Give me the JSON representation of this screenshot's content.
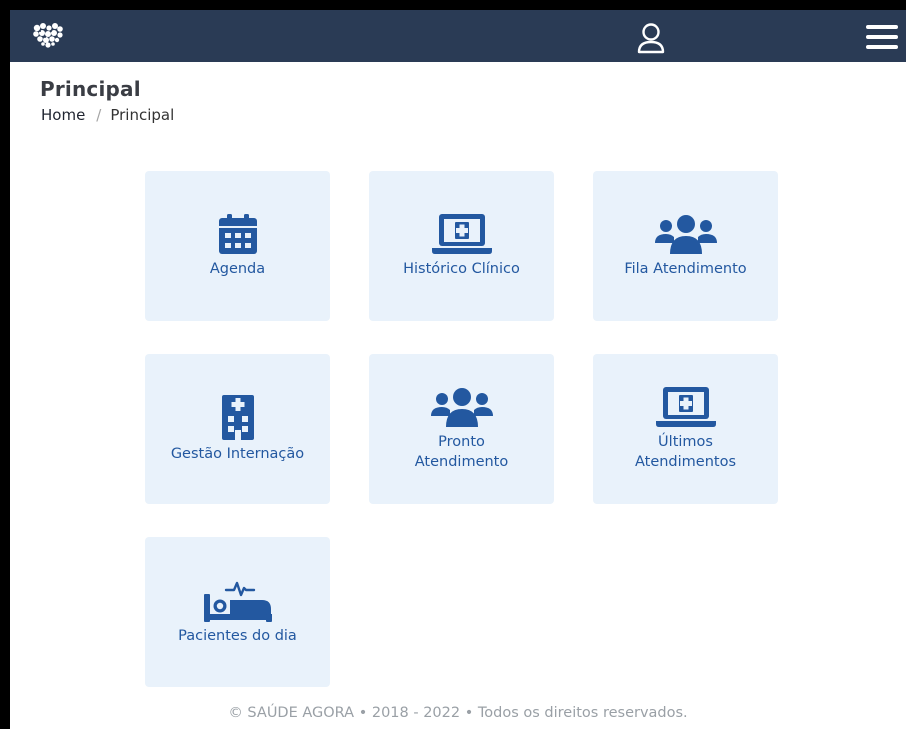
{
  "header": {
    "logo_icon": "heart-logo-icon",
    "user_icon": "user-icon",
    "menu_icon": "hamburger-menu-icon",
    "background_color": "#2a3b55"
  },
  "page": {
    "title": "Principal",
    "breadcrumb": {
      "home": "Home",
      "separator": "/",
      "current": "Principal"
    }
  },
  "tiles": [
    {
      "label": "Agenda",
      "icon": "calendar-icon"
    },
    {
      "label": "Histórico Clínico",
      "icon": "laptop-medical-icon"
    },
    {
      "label": "Fila Atendimento",
      "icon": "users-icon"
    },
    {
      "label": "Gestão Internação",
      "icon": "hospital-icon"
    },
    {
      "label": "Pronto Atendimento",
      "icon": "users-icon"
    },
    {
      "label": "Últimos Atendimentos",
      "icon": "laptop-medical-icon"
    },
    {
      "label": "Pacientes do dia",
      "icon": "bed-pulse-icon"
    }
  ],
  "footer": {
    "text": "© SAÚDE AGORA • 2018 - 2022 • Todos os direitos reservados."
  },
  "colors": {
    "accent": "#2358a0",
    "tile_background": "#e9f2fb"
  }
}
